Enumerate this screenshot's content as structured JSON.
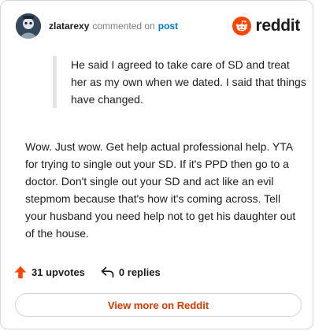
{
  "header": {
    "username": "zlatarexy",
    "action_text": "commented on",
    "target_text": "post",
    "brand_name": "reddit"
  },
  "quote": {
    "text": "He said I agreed to take care of SD and treat her as my own when we dated. I said that things have changed."
  },
  "comment": {
    "text": "Wow. Just wow. Get help actual professional help. YTA for trying to single out your SD. If it's PPD then go to a doctor. Don't single out your SD and act like an evil stepmom because that's how it's coming across. Tell your husband you need help not to get his daughter out of the house."
  },
  "actions": {
    "upvotes_label": "31 upvotes",
    "replies_label": "0 replies"
  },
  "footer": {
    "view_more_label": "View more on Reddit"
  },
  "colors": {
    "brand": "#ff4500",
    "link": "#0079d3",
    "cta": "#d93a00",
    "upvote": "#ff4500"
  },
  "icons": {
    "avatar": "user-avatar",
    "brand": "reddit-snoo-icon",
    "upvote": "upvote-arrow-icon",
    "reply": "reply-arrow-icon"
  }
}
